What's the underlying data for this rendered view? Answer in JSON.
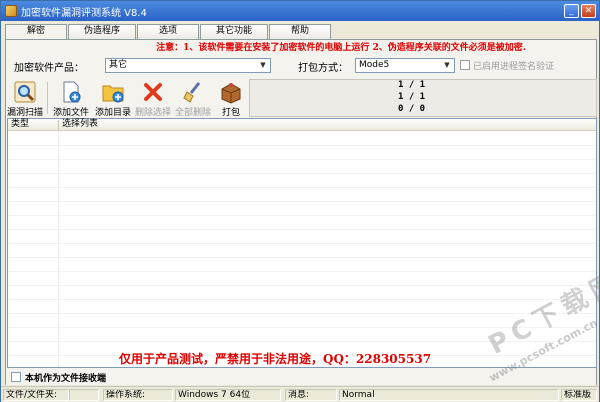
{
  "window": {
    "title": "加密软件漏洞评测系统  V8.4"
  },
  "tabs": [
    "解密",
    "伪造程序",
    "选项",
    "其它功能",
    "帮助"
  ],
  "notice": "注意：1、该软件需要在安装了加密软件的电脑上运行  2、伪造程序关联的文件必须是被加密.",
  "form": {
    "product_label": "加密软件产品：",
    "product_value": "其它",
    "pack_label": "打包方式：",
    "pack_value": "Mode5",
    "sign_label": "已启用进程签名验证"
  },
  "toolbar": [
    {
      "label": "漏洞扫描",
      "icon": "magnifier-icon",
      "enabled": true
    },
    {
      "label": "添加文件",
      "icon": "add-file-icon",
      "enabled": true
    },
    {
      "label": "添加目录",
      "icon": "add-folder-icon",
      "enabled": true
    },
    {
      "label": "删除选择",
      "icon": "delete-icon",
      "enabled": false
    },
    {
      "label": "全部删除",
      "icon": "broom-icon",
      "enabled": false
    },
    {
      "label": "打包",
      "icon": "package-icon",
      "enabled": true
    }
  ],
  "counts": [
    "1 / 1",
    "1 / 1",
    "0 / 0"
  ],
  "list": {
    "columns": [
      "类型",
      "选择列表"
    ]
  },
  "warning": "仅用于产品测试，严禁用于非法用途，QQ：228305537",
  "receiver_label": "本机作为文件接收端",
  "statusbar": {
    "file_label": "文件/文件夹:",
    "file_value": "",
    "os_label": "操作系统:",
    "os_value": "Windows 7 64位",
    "msg_label": "消息:",
    "msg_value": "Normal",
    "mode": "标准版"
  },
  "watermark": {
    "big": "PC下载网",
    "small": "www.pcsoft.com.cn"
  }
}
